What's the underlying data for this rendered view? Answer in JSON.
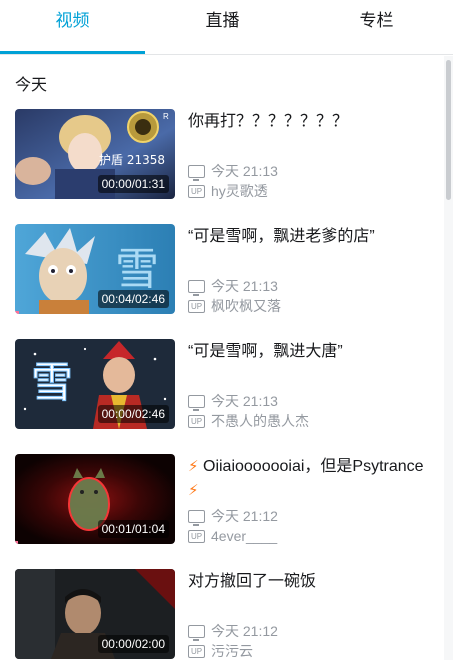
{
  "tabs": [
    {
      "label": "视频"
    },
    {
      "label": "直播"
    },
    {
      "label": "专栏"
    }
  ],
  "section": {
    "title": "今天"
  },
  "items": [
    {
      "title": "你再打？？？？？？？",
      "time": "今天 21:13",
      "up": "hy灵歌透",
      "duration": "00:00/01:31",
      "progress": 0.0,
      "thumb_text": "护盾 21358"
    },
    {
      "title": "“可是雪啊，飘进老爹的店”",
      "time": "今天 21:13",
      "up": "枫吹枫又落",
      "duration": "00:04/02:46",
      "progress": 0.024,
      "thumb_text": "雪"
    },
    {
      "title": "“可是雪啊，飘进大唐”",
      "time": "今天 21:13",
      "up": "不愚人的愚人杰",
      "duration": "00:00/02:46",
      "progress": 0.0,
      "thumb_text": "雪"
    },
    {
      "title": "Oiiaiooooooiai，但是Psytrance",
      "time": "今天 21:12",
      "up": "4ever____",
      "duration": "00:01/01:04",
      "progress": 0.016
    },
    {
      "title": "对方撤回了一碗饭",
      "time": "今天 21:12",
      "up": "污污云",
      "duration": "00:00/02:00",
      "progress": 0.0
    }
  ],
  "icons": {
    "time": "monitor-icon",
    "up": "up-badge-icon",
    "bolt": "lightning-icon"
  },
  "colors": {
    "accent": "#00a1d6",
    "progress": "#fb7299",
    "muted": "#9499a0",
    "bolt": "#ff7a1a"
  }
}
